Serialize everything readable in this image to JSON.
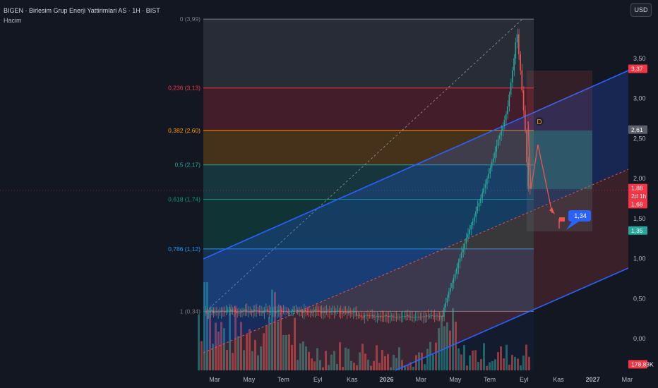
{
  "header": {
    "symbol_line": "BIGEN · Birlesim Grup Enerji Yattirimlari AS · 1H · BIST",
    "volume_label": "Hacim"
  },
  "currency_button": "USD",
  "colors": {
    "background": "#131722",
    "up": "#26a69a",
    "down": "#ef5350",
    "channel": "#2962ff",
    "fib_0": "#787b86",
    "fib_236": "#f23645",
    "fib_382": "#ff9800",
    "fib_5": "#4caf50",
    "fib_618": "#089981",
    "fib_786": "#2196f3",
    "fib_1": "#787b86"
  },
  "fib_levels": [
    {
      "label": "0 (3,99)",
      "price": 3.99,
      "color": "#787b86"
    },
    {
      "label": "0,236 (3,13)",
      "price": 3.13,
      "color": "#f23645"
    },
    {
      "label": "0,382 (2,60)",
      "price": 2.6,
      "color": "#ff9800"
    },
    {
      "label": "0,5 (2,17)",
      "price": 2.17,
      "color": "#26a69a"
    },
    {
      "label": "0,618 (1,74)",
      "price": 1.74,
      "color": "#089981"
    },
    {
      "label": "0,786 (1,12)",
      "price": 1.12,
      "color": "#2196f3"
    },
    {
      "label": "1 (0,34)",
      "price": 0.34,
      "color": "#787b86"
    }
  ],
  "price_axis": {
    "ticks": [
      "3,50",
      "3,00",
      "2,50",
      "2,00",
      "1,50",
      "1,00",
      "0,50",
      "0,00"
    ],
    "tick_values": [
      3.5,
      3.0,
      2.5,
      2.0,
      1.5,
      1.0,
      0.5,
      0.0
    ]
  },
  "price_badges": [
    {
      "text": "3,37",
      "value": 3.37,
      "color": "#f23645"
    },
    {
      "text": "2,61",
      "value": 2.61,
      "color": "#5d606b"
    },
    {
      "text": "1,88",
      "value": 1.88,
      "color": "#f23645"
    },
    {
      "text": "2d 1h",
      "value": 1.78,
      "color": "#f23645"
    },
    {
      "text": "1,68",
      "value": 1.68,
      "color": "#f23645"
    },
    {
      "text": "1,35",
      "value": 1.35,
      "color": "#26a69a"
    },
    {
      "text": "178,83K",
      "value": -0.32,
      "color": "#f23645"
    }
  ],
  "time_axis": {
    "labels": [
      "Mar",
      "May",
      "Tem",
      "Eyl",
      "Kas",
      "2026",
      "Mar",
      "May",
      "Tem",
      "Eyl",
      "Kas",
      "2027",
      "Mar"
    ],
    "bold": [
      false,
      false,
      false,
      false,
      false,
      true,
      false,
      false,
      false,
      false,
      false,
      true,
      false
    ]
  },
  "annotations": {
    "wave_label": "D",
    "target_label": "1,34"
  }
}
